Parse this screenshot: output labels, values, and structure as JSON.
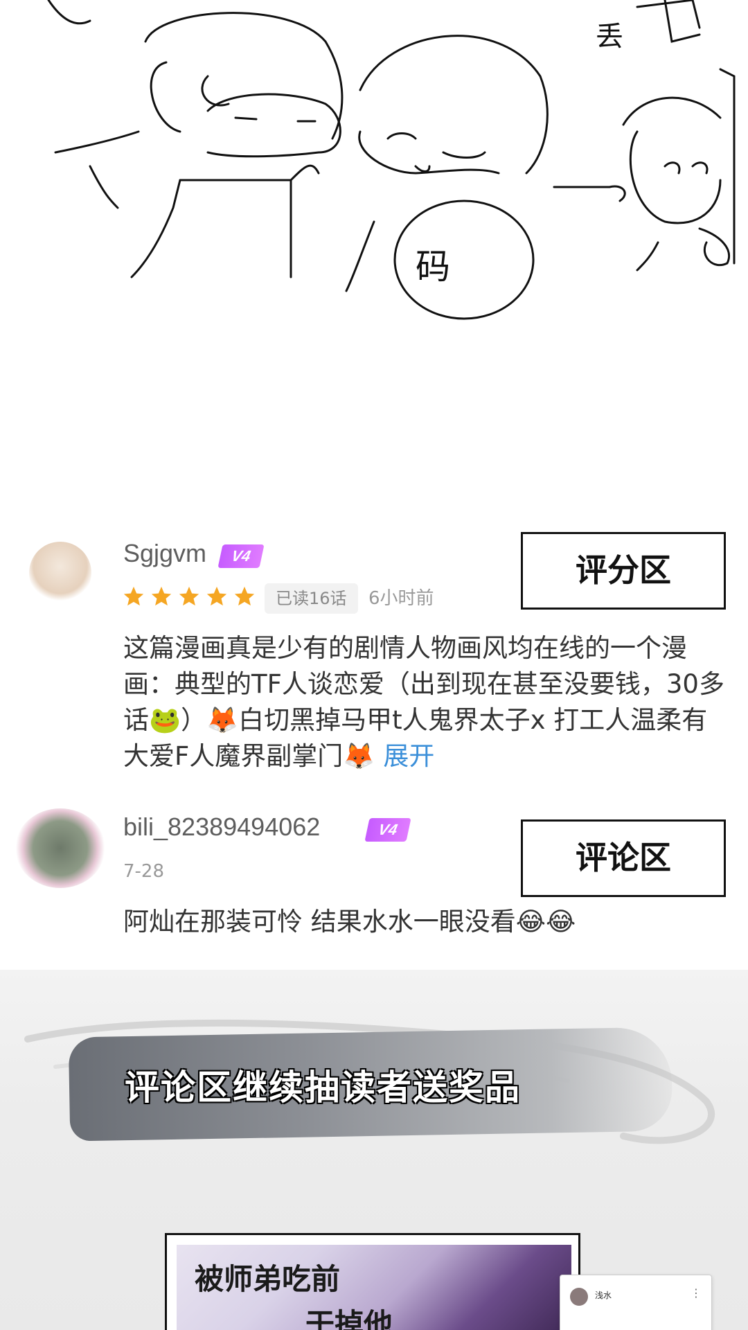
{
  "sketch": {
    "bubble_text": "码",
    "corner_text": "丢"
  },
  "comments": [
    {
      "username": "Sgjgvm",
      "vip_level": "V4",
      "rating": 5,
      "read_progress": "已读16话",
      "time": "6小时前",
      "text": "这篇漫画真是少有的剧情人物画风均在线的一个漫画：典型的TF人谈恋爱（出到现在甚至没要钱，30多话🐸）🦊白切黑掉马甲t人鬼界太子x 打工人温柔有大爱F人魔界副掌门🦊",
      "expand_label": "展开",
      "area_label": "评分区"
    },
    {
      "username": "bili_82389494062",
      "vip_level": "V4",
      "date": "7-28",
      "text": "阿灿在那装可怜 结果水水一眼没看😂😂",
      "area_label": "评论区"
    }
  ],
  "promo": {
    "title": "评论区继续抽读者送奖品",
    "poster_line1": "被师弟吃前",
    "poster_line2": "干掉他",
    "mini_card_name": "浅水",
    "mini_card_more": "⋮"
  },
  "colors": {
    "vip_badge": "#c65cff",
    "star": "#f5a623",
    "expand_link": "#3b8fd9"
  }
}
